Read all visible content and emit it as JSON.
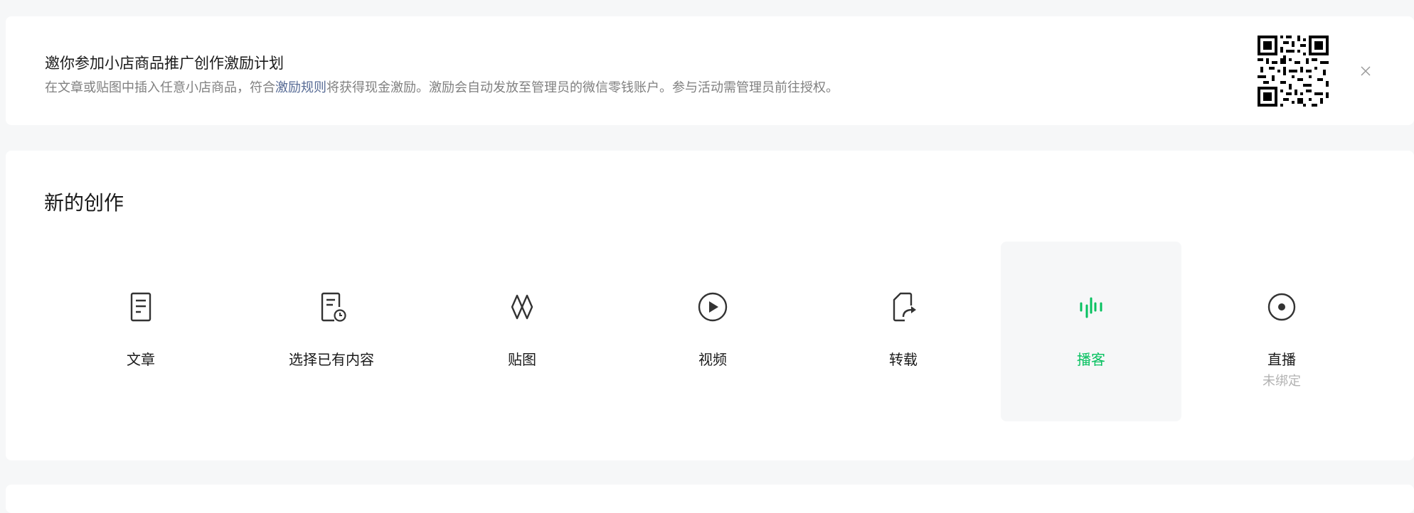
{
  "banner": {
    "title": "邀你参加小店商品推广创作激励计划",
    "desc_before": "在文章或贴图中插入任意小店商品，符合",
    "desc_link": "激励规则",
    "desc_after": "将获得现金激励。激励会自动发放至管理员的微信零钱账户。参与活动需管理员前往授权。"
  },
  "creation": {
    "title": "新的创作",
    "items": [
      {
        "label": "文章",
        "icon": "article-icon"
      },
      {
        "label": "选择已有内容",
        "icon": "existing-content-icon"
      },
      {
        "label": "贴图",
        "icon": "image-post-icon"
      },
      {
        "label": "视频",
        "icon": "video-play-icon"
      },
      {
        "label": "转载",
        "icon": "repost-icon"
      },
      {
        "label": "播客",
        "icon": "podcast-icon",
        "active": true
      },
      {
        "label": "直播",
        "sub": "未绑定",
        "icon": "live-icon"
      }
    ]
  },
  "colors": {
    "accent": "#07c160",
    "link": "#576b95",
    "muted": "#808080",
    "page_bg": "#f6f7f8"
  }
}
